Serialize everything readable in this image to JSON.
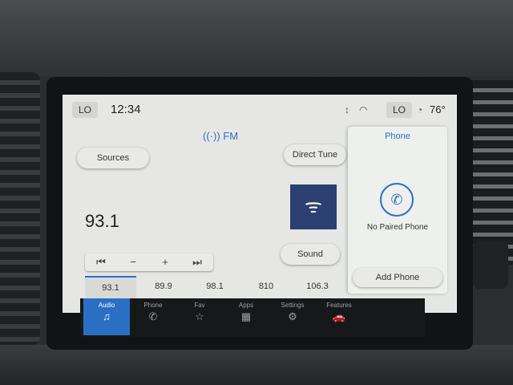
{
  "status": {
    "left_lo": "LO",
    "time": "12:34",
    "right_lo": "LO",
    "temperature": "76°"
  },
  "radio": {
    "band": "FM",
    "sources_label": "Sources",
    "direct_tune_label": "Direct Tune",
    "frequency": "93.1",
    "sound_label": "Sound",
    "seek_back_icon": "⏮",
    "minus": "−",
    "plus": "+",
    "seek_forward_icon": "⏭",
    "presets": [
      "93.1",
      "89.9",
      "98.1",
      "810",
      "106.3"
    ]
  },
  "phone": {
    "title": "Phone",
    "message": "No Paired Phone",
    "add_label": "Add Phone"
  },
  "dock": {
    "items": [
      {
        "label": "Audio",
        "icon": "music-note-icon"
      },
      {
        "label": "Phone",
        "icon": "phone-icon"
      },
      {
        "label": "Fav",
        "icon": "star-icon"
      },
      {
        "label": "Apps",
        "icon": "apps-grid-icon"
      },
      {
        "label": "Settings",
        "icon": "settings-icon"
      },
      {
        "label": "Features",
        "icon": "car-icon"
      }
    ]
  },
  "colors": {
    "accent": "#2b6fc4",
    "screen_bg": "#e6e7e5",
    "dock_bg": "#17181a"
  }
}
